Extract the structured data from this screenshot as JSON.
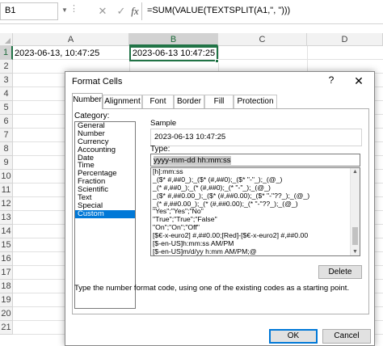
{
  "formula_bar": {
    "name_box": "B1",
    "cancel_glyph": "✕",
    "enter_glyph": "✓",
    "fx_glyph": "fx",
    "formula": "=SUM(VALUE(TEXTSPLIT(A1,\", \")))"
  },
  "grid": {
    "columns": [
      "A",
      "B",
      "C",
      "D"
    ],
    "rows": [
      "1",
      "2",
      "3",
      "4",
      "5",
      "6",
      "7",
      "8",
      "9",
      "10",
      "11",
      "12",
      "13",
      "14",
      "15",
      "16",
      "17",
      "18",
      "19",
      "20",
      "21"
    ],
    "cells": {
      "A1": "2023-06-13, 10:47:25",
      "B1": "2023-06-13 10:47:25"
    },
    "selected_cell": "B1",
    "accent_color": "#217346"
  },
  "dialog": {
    "title": "Format Cells",
    "help_glyph": "?",
    "close_glyph": "✕",
    "tabs": [
      {
        "label": "Number"
      },
      {
        "label": "Alignment"
      },
      {
        "label": "Font"
      },
      {
        "label": "Border"
      },
      {
        "label": "Fill"
      },
      {
        "label": "Protection"
      }
    ],
    "active_tab": "Number",
    "category_label": "Category:",
    "categories": [
      "General",
      "Number",
      "Currency",
      "Accounting",
      "Date",
      "Time",
      "Percentage",
      "Fraction",
      "Scientific",
      "Text",
      "Special",
      "Custom"
    ],
    "selected_category": "Custom",
    "sample_label": "Sample",
    "sample_value": "2023-06-13 10:47:25",
    "type_label": "Type:",
    "type_value": "yyyy-mm-dd hh:mm:ss",
    "format_codes": [
      "[h]:mm:ss",
      "_($* #,##0_);_($* (#,##0);_($* \"-\"_);_(@_)",
      "_(* #,##0_);_(* (#,##0);_(* \"-\"_);_(@_)",
      "_($* #,##0.00_);_($* (#,##0.00);_($* \"-\"??_);_(@_)",
      "_(* #,##0.00_);_(* (#,##0.00);_(* \"-\"??_);_(@_)",
      "\"Yes\";\"Yes\";\"No\"",
      "\"True\";\"True\";\"False\"",
      "\"On\";\"On\";\"Off\"",
      "[$€-x-euro2] #,##0.00;[Red]-[$€-x-euro2] #,##0.00",
      "[$-en-US]h:mm:ss AM/PM",
      "[$-en-US]m/d/yy h:mm AM/PM;@",
      "yyyy-mm-dd hh:mm:ss"
    ],
    "selected_format": "yyyy-mm-dd hh:mm:ss",
    "delete_label": "Delete",
    "hint": "Type the number format code, using one of the existing codes as a starting point.",
    "ok_label": "OK",
    "cancel_label": "Cancel",
    "selection_color": "#0078d7"
  }
}
